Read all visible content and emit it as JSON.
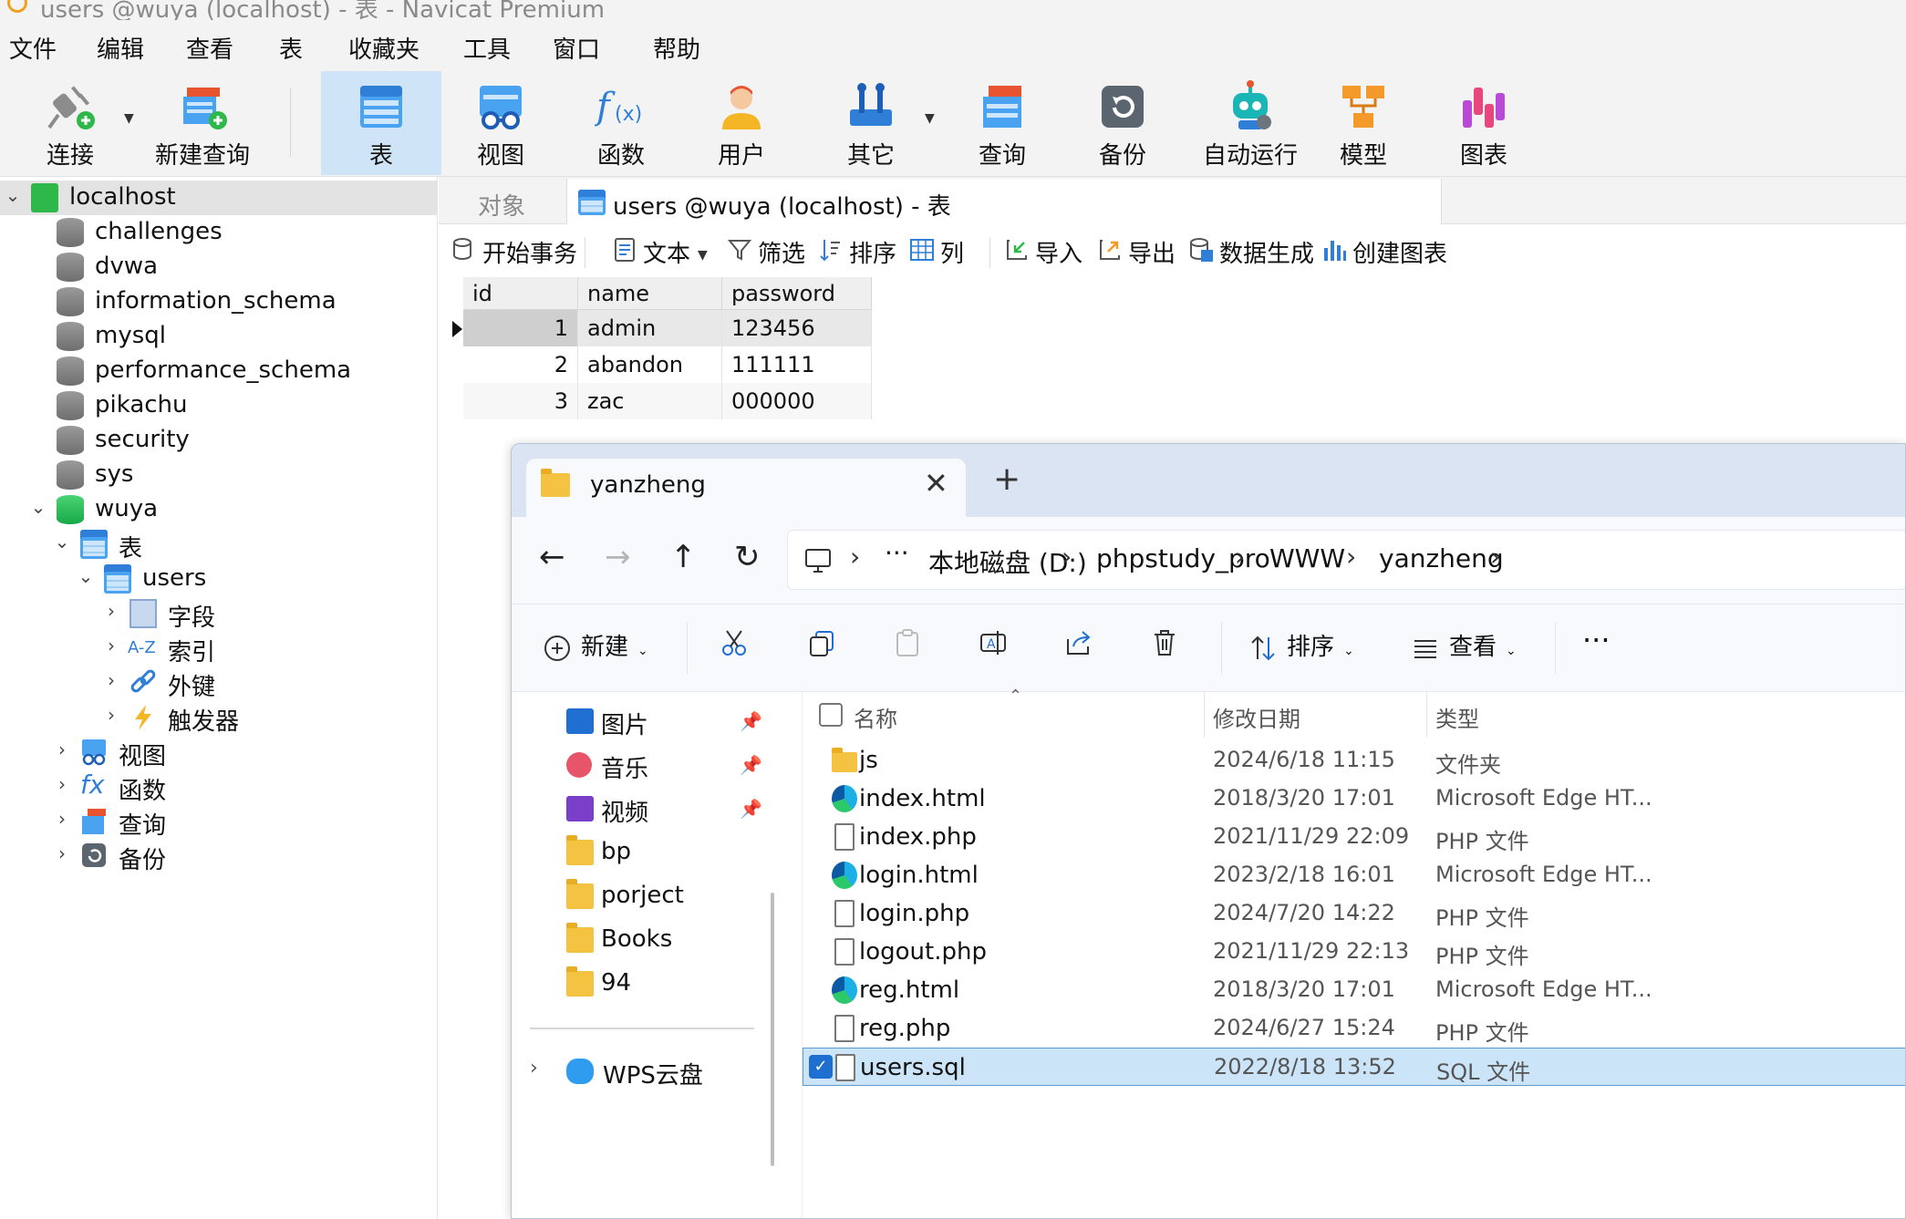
{
  "window": {
    "title": "users @wuya (localhost) - 表 - Navicat Premium"
  },
  "menu": [
    "文件",
    "编辑",
    "查看",
    "表",
    "收藏夹",
    "工具",
    "窗口",
    "帮助"
  ],
  "toolbar": {
    "connect": "连接",
    "new_query": "新建查询",
    "table": "表",
    "view": "视图",
    "function": "函数",
    "user": "用户",
    "other": "其它",
    "query": "查询",
    "backup": "备份",
    "automation": "自动运行",
    "model": "模型",
    "chart": "图表"
  },
  "tree": {
    "connection": "localhost",
    "databases": [
      "challenges",
      "dvwa",
      "information_schema",
      "mysql",
      "performance_schema",
      "pikachu",
      "security",
      "sys"
    ],
    "open_db": "wuya",
    "tables_group": "表",
    "table": "users",
    "table_children": [
      "字段",
      "索引",
      "外键",
      "触发器"
    ],
    "groups": [
      "视图",
      "函数",
      "查询",
      "备份"
    ]
  },
  "tabs": {
    "objects": "对象",
    "active": "users @wuya (localhost) - 表"
  },
  "subtoolbar": {
    "begin_tx": "开始事务",
    "text": "文本",
    "filter": "筛选",
    "sort": "排序",
    "columns": "列",
    "import": "导入",
    "export": "导出",
    "datagen": "数据生成",
    "create_chart": "创建图表"
  },
  "grid": {
    "columns": [
      "id",
      "name",
      "password"
    ],
    "rows": [
      {
        "id": "1",
        "name": "admin",
        "password": "123456"
      },
      {
        "id": "2",
        "name": "abandon",
        "password": "111111"
      },
      {
        "id": "3",
        "name": "zac",
        "password": "000000"
      }
    ]
  },
  "explorer": {
    "tab_title": "yanzheng",
    "breadcrumb": [
      "本地磁盘 (D:)",
      "phpstudy_pro",
      "WWW",
      "yanzheng"
    ],
    "commands": {
      "new": "新建",
      "sort": "排序",
      "view": "查看"
    },
    "sidebar": [
      {
        "label": "图片",
        "pinned": true
      },
      {
        "label": "音乐",
        "pinned": true
      },
      {
        "label": "视频",
        "pinned": true
      },
      {
        "label": "bp",
        "pinned": false
      },
      {
        "label": "porject",
        "pinned": false
      },
      {
        "label": "Books",
        "pinned": false
      },
      {
        "label": "94",
        "pinned": false
      }
    ],
    "wps": "WPS云盘",
    "columns": {
      "name": "名称",
      "date": "修改日期",
      "type": "类型"
    },
    "files": [
      {
        "name": "js",
        "date": "2024/6/18 11:15",
        "type": "文件夹",
        "icon": "folder"
      },
      {
        "name": "index.html",
        "date": "2018/3/20 17:01",
        "type": "Microsoft Edge HT...",
        "icon": "edge"
      },
      {
        "name": "index.php",
        "date": "2021/11/29 22:09",
        "type": "PHP 文件",
        "icon": "file"
      },
      {
        "name": "login.html",
        "date": "2023/2/18 16:01",
        "type": "Microsoft Edge HT...",
        "icon": "edge"
      },
      {
        "name": "login.php",
        "date": "2024/7/20 14:22",
        "type": "PHP 文件",
        "icon": "file"
      },
      {
        "name": "logout.php",
        "date": "2021/11/29 22:13",
        "type": "PHP 文件",
        "icon": "file"
      },
      {
        "name": "reg.html",
        "date": "2018/3/20 17:01",
        "type": "Microsoft Edge HT...",
        "icon": "edge"
      },
      {
        "name": "reg.php",
        "date": "2024/6/27 15:24",
        "type": "PHP 文件",
        "icon": "file"
      },
      {
        "name": "users.sql",
        "date": "2022/8/18 13:52",
        "type": "SQL 文件",
        "icon": "file",
        "selected": true
      }
    ]
  }
}
